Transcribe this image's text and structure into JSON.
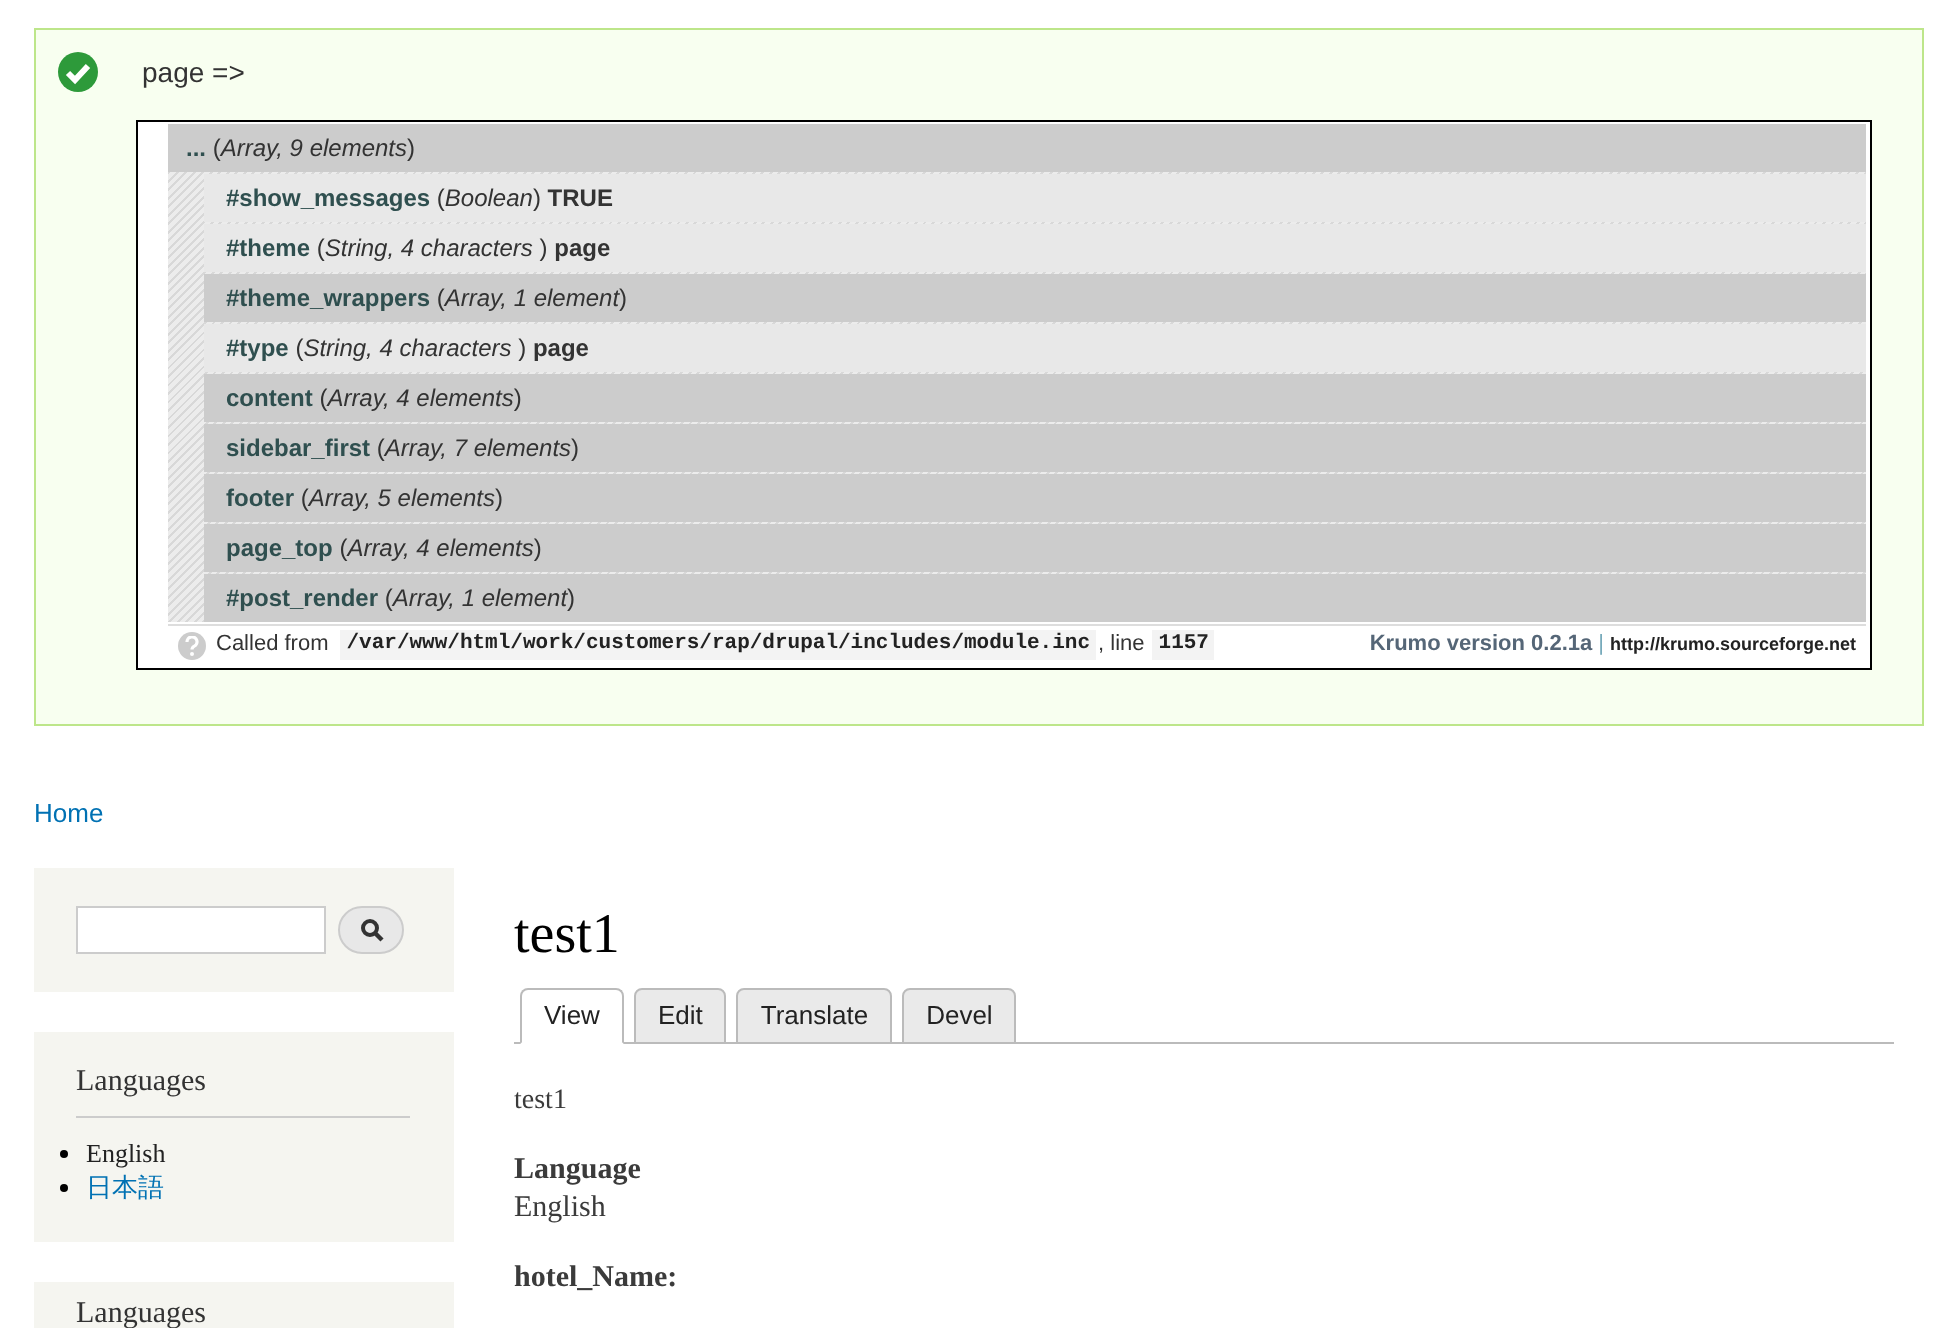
{
  "message": {
    "label": "page =>"
  },
  "krumo": {
    "root": {
      "key": "...",
      "meta": "(*Array, 9 elements*)"
    },
    "rows": [
      {
        "kind": "scalar",
        "key": "#show_messages",
        "meta": "(*Boolean*)",
        "value": "TRUE"
      },
      {
        "kind": "scalar",
        "key": "#theme",
        "meta": "(*String, 4 characters* )",
        "value": "page"
      },
      {
        "kind": "array",
        "key": "#theme_wrappers",
        "meta": "(*Array, 1 element*)"
      },
      {
        "kind": "scalar",
        "key": "#type",
        "meta": "(*String, 4 characters* )",
        "value": "page"
      },
      {
        "kind": "array",
        "key": "content",
        "meta": "(*Array, 4 elements*)"
      },
      {
        "kind": "array",
        "key": "sidebar_first",
        "meta": "(*Array, 7 elements*)"
      },
      {
        "kind": "array",
        "key": "footer",
        "meta": "(*Array, 5 elements*)"
      },
      {
        "kind": "array",
        "key": "page_top",
        "meta": "(*Array, 4 elements*)"
      },
      {
        "kind": "array",
        "key": "#post_render",
        "meta": "(*Array, 1 element*)"
      }
    ],
    "footer": {
      "called_from": "Called from",
      "path": "/var/www/html/work/customers/rap/drupal/includes/module.inc",
      "line_label": ", line",
      "line": "1157",
      "version": "Krumo version 0.2.1a",
      "separator": "|",
      "url": "http://krumo.sourceforge.net"
    }
  },
  "breadcrumb": "Home",
  "sidebar": {
    "blocks": [
      {
        "title": "Languages",
        "items": [
          {
            "label": "English",
            "selected": true
          },
          {
            "label": "日本語",
            "selected": false
          }
        ]
      },
      {
        "title": "Languages"
      }
    ]
  },
  "main": {
    "title": "test1",
    "tabs": [
      {
        "label": "View",
        "selected": true
      },
      {
        "label": "Edit",
        "selected": false
      },
      {
        "label": "Translate",
        "selected": false
      },
      {
        "label": "Devel",
        "selected": false
      }
    ],
    "body": "test1",
    "fields": [
      {
        "label": "Language",
        "value": "English"
      },
      {
        "label": "hotel_Name:"
      }
    ]
  }
}
